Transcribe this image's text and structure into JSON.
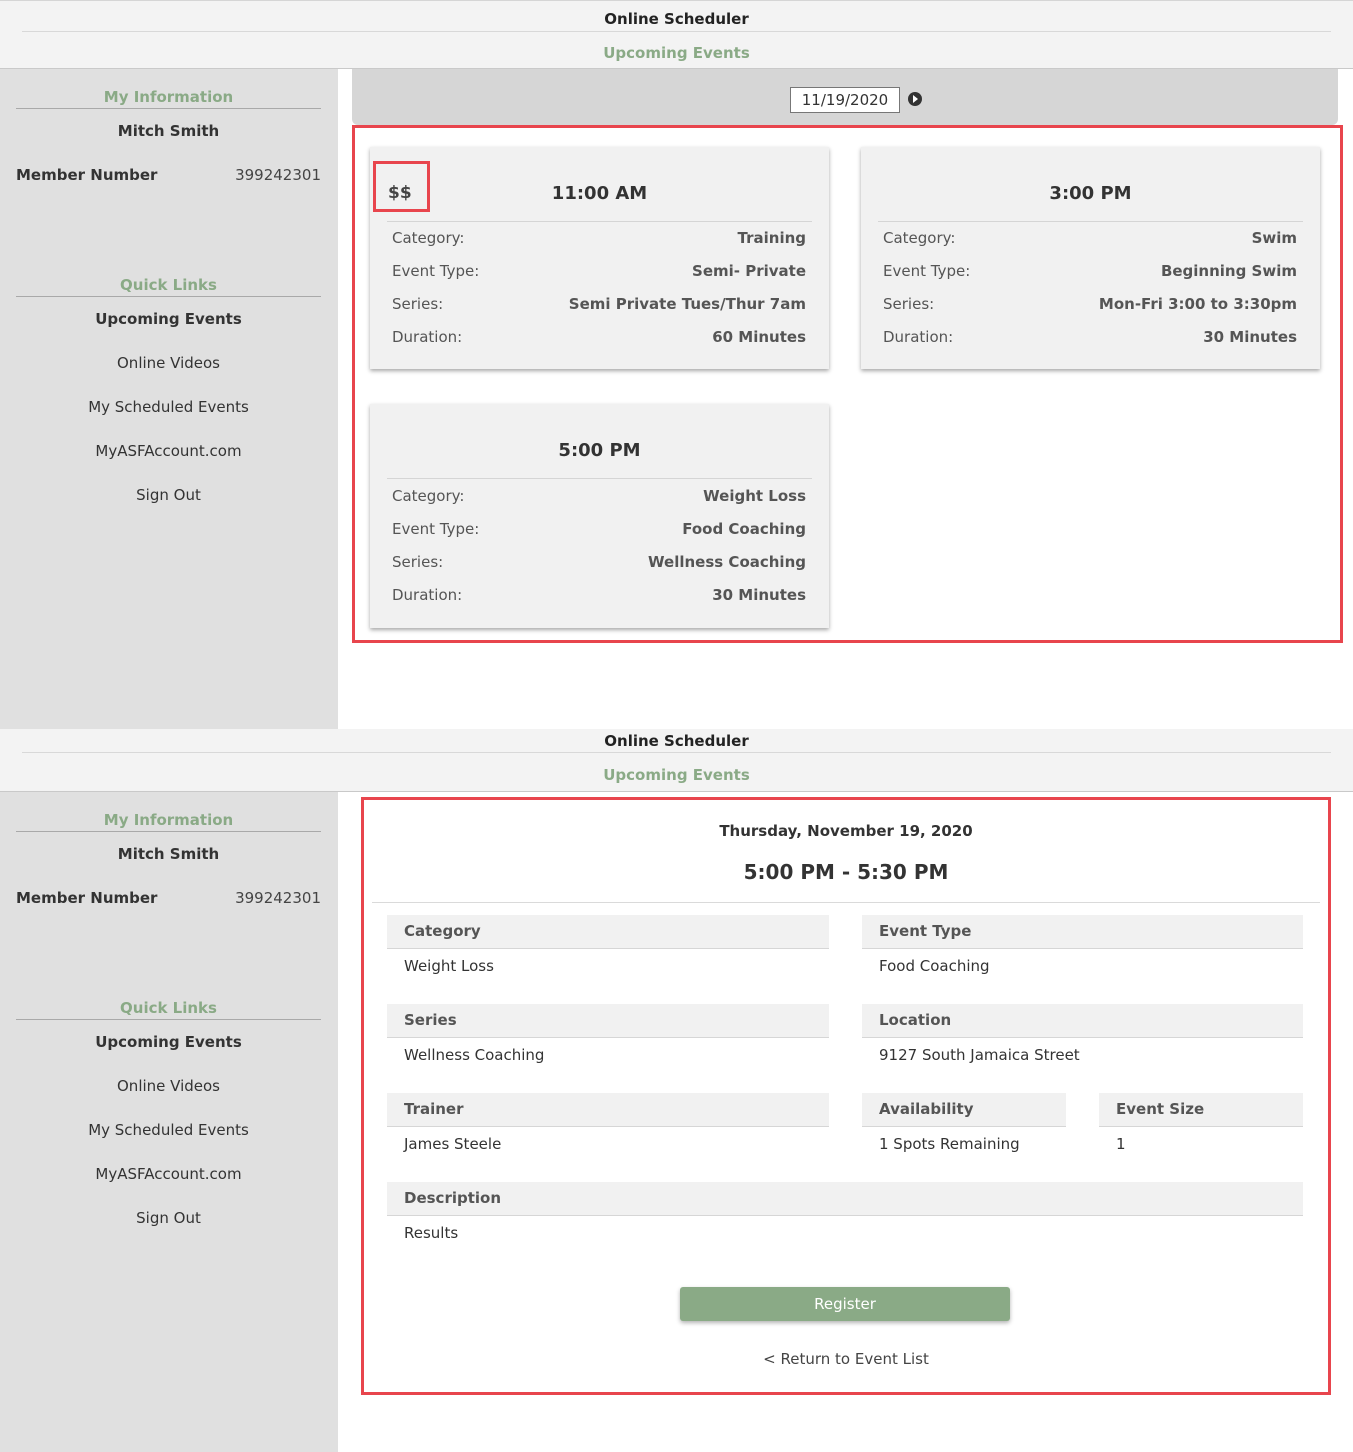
{
  "header": {
    "app_title": "Online Scheduler",
    "subtitle": "Upcoming Events"
  },
  "sidebar": {
    "my_info_heading": "My Information",
    "member_name": "Mitch Smith",
    "member_number_label": "Member Number",
    "member_number": "399242301",
    "quick_links_heading": "Quick Links",
    "links": [
      {
        "label": "Upcoming Events",
        "active": true
      },
      {
        "label": "Online Videos",
        "active": false
      },
      {
        "label": "My Scheduled Events",
        "active": false
      },
      {
        "label": "MyASFAccount.com",
        "active": false
      },
      {
        "label": "Sign Out",
        "active": false
      }
    ]
  },
  "event_list": {
    "date_value": "11/19/2020",
    "field_labels": {
      "category": "Category:",
      "event_type": "Event Type:",
      "series": "Series:",
      "duration": "Duration:"
    },
    "cards": [
      {
        "price": "$$",
        "time": "11:00 AM",
        "category": "Training",
        "event_type": "Semi- Private",
        "series": "Semi Private Tues/Thur 7am",
        "duration": "60 Minutes"
      },
      {
        "price": "",
        "time": "3:00 PM",
        "category": "Swim",
        "event_type": "Beginning Swim",
        "series": "Mon-Fri 3:00 to 3:30pm",
        "duration": "30 Minutes"
      },
      {
        "price": "",
        "time": "5:00 PM",
        "category": "Weight Loss",
        "event_type": "Food Coaching",
        "series": "Wellness Coaching",
        "duration": "30 Minutes"
      }
    ]
  },
  "event_detail": {
    "date": "Thursday, November 19, 2020",
    "time_range": "5:00 PM - 5:30 PM",
    "fields": {
      "category": {
        "label": "Category",
        "value": "Weight Loss"
      },
      "event_type": {
        "label": "Event Type",
        "value": "Food Coaching"
      },
      "series": {
        "label": "Series",
        "value": "Wellness Coaching"
      },
      "location": {
        "label": "Location",
        "value": "9127 South Jamaica Street"
      },
      "trainer": {
        "label": "Trainer",
        "value": "James Steele"
      },
      "availability": {
        "label": "Availability",
        "value": "1 Spots Remaining"
      },
      "event_size": {
        "label": "Event Size",
        "value": "1"
      },
      "description": {
        "label": "Description",
        "value": "Results"
      }
    },
    "register_label": "Register",
    "return_link": "< Return to Event List"
  },
  "colors": {
    "accent_green": "#8aaa86",
    "highlight_red": "#e8454d",
    "sidebar_bg": "#e0e0e0",
    "card_bg": "#f1f1f1"
  }
}
